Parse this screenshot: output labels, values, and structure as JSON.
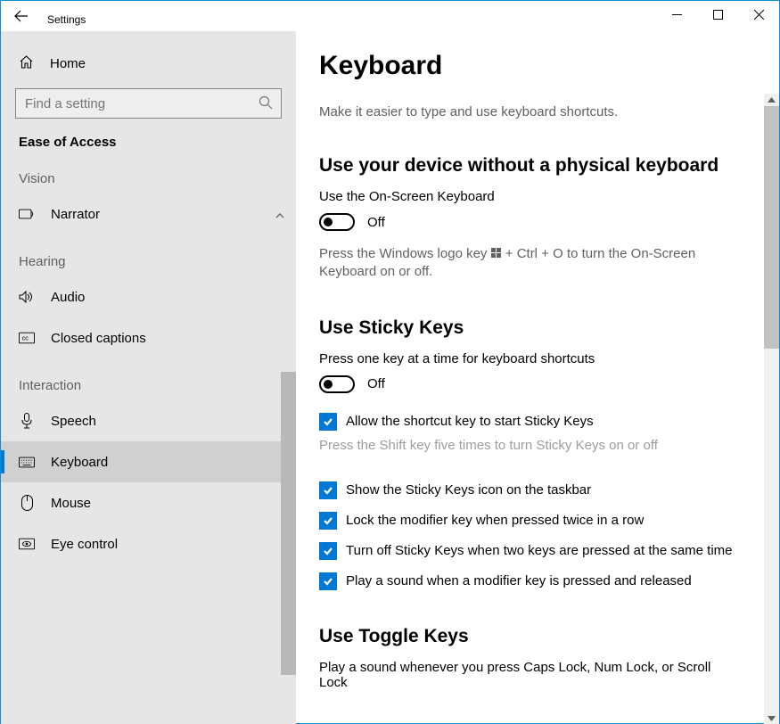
{
  "window": {
    "title": "Settings"
  },
  "sidebar": {
    "home_label": "Home",
    "search_placeholder": "Find a setting",
    "section": "Ease of Access",
    "groups": [
      {
        "label": "Vision",
        "items": [
          {
            "label": "Narrator"
          }
        ]
      },
      {
        "label": "Hearing",
        "items": [
          {
            "label": "Audio"
          },
          {
            "label": "Closed captions"
          }
        ]
      },
      {
        "label": "Interaction",
        "items": [
          {
            "label": "Speech"
          },
          {
            "label": "Keyboard",
            "selected": true
          },
          {
            "label": "Mouse"
          },
          {
            "label": "Eye control"
          }
        ]
      }
    ]
  },
  "main": {
    "title": "Keyboard",
    "subtitle": "Make it easier to type and use keyboard shortcuts.",
    "onscreen": {
      "heading": "Use your device without a physical keyboard",
      "label": "Use the On-Screen Keyboard",
      "toggle_state": "Off",
      "hint_pre": "Press the Windows logo key ",
      "hint_post": " + Ctrl + O to turn the On-Screen Keyboard on or off."
    },
    "sticky": {
      "heading": "Use Sticky Keys",
      "label": "Press one key at a time for keyboard shortcuts",
      "toggle_state": "Off",
      "shortcut_check": "Allow the shortcut key to start Sticky Keys",
      "shortcut_hint": "Press the Shift key five times to turn Sticky Keys on or off",
      "options": [
        "Show the Sticky Keys icon on the taskbar",
        "Lock the modifier key when pressed twice in a row",
        "Turn off Sticky Keys when two keys are pressed at the same time",
        "Play a sound when a modifier key is pressed and released"
      ]
    },
    "toggle_keys": {
      "heading": "Use Toggle Keys",
      "label": "Play a sound whenever you press Caps Lock, Num Lock, or Scroll Lock"
    }
  }
}
